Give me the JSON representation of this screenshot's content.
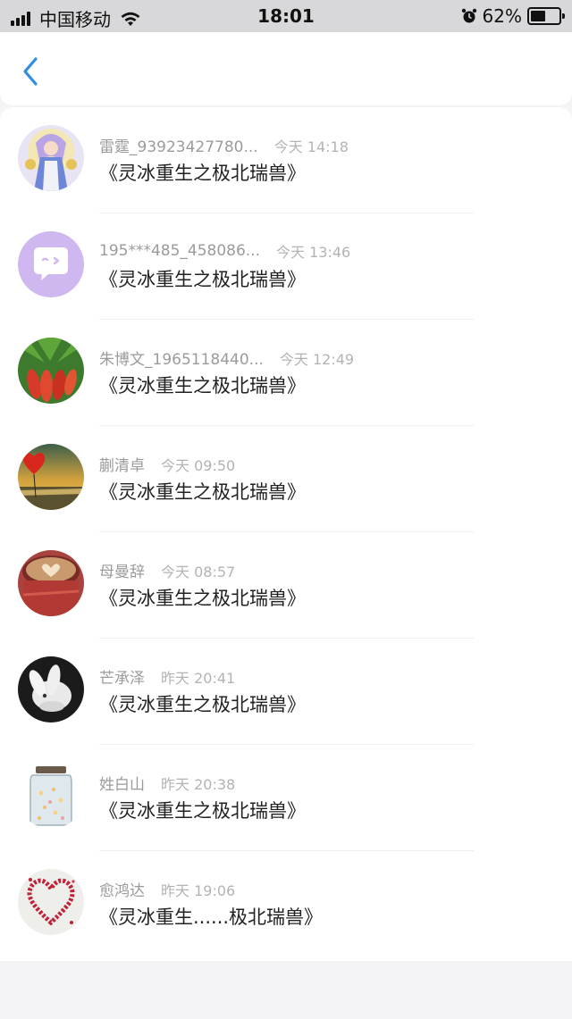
{
  "status_bar": {
    "carrier": "中国移动",
    "time": "18:01",
    "battery_percent": "62%",
    "battery_level": 0.62
  },
  "nav": {
    "back_icon": "chevron-left-icon",
    "accent_color": "#2f8fe5"
  },
  "messages": [
    {
      "name": "雷霆_93923427780...",
      "time": "今天 14:18",
      "title": "《灵冰重生之极北瑞兽》",
      "avatar": "anime-character-avatar"
    },
    {
      "name": "195***485_458086...",
      "time": "今天 13:46",
      "title": "《灵冰重生之极北瑞兽》",
      "avatar": "default-chat-bubble-avatar"
    },
    {
      "name": "朱博文_1965118440...",
      "time": "今天 12:49",
      "title": "《灵冰重生之极北瑞兽》",
      "avatar": "red-peppers-avatar"
    },
    {
      "name": "蒯清卓",
      "time": "今天 09:50",
      "title": "《灵冰重生之极北瑞兽》",
      "avatar": "heart-balloon-sunset-avatar"
    },
    {
      "name": "母曼辞",
      "time": "今天 08:57",
      "title": "《灵冰重生之极北瑞兽》",
      "avatar": "latte-art-avatar"
    },
    {
      "name": "芒承泽",
      "time": "昨天 20:41",
      "title": "《灵冰重生之极北瑞兽》",
      "avatar": "white-rabbit-avatar"
    },
    {
      "name": "姓白山",
      "time": "昨天 20:38",
      "title": "《灵冰重生之极北瑞兽》",
      "avatar": "glass-jar-lights-avatar"
    },
    {
      "name": "愈鸿达",
      "time": "昨天 19:06",
      "title": "《灵冰重生......极北瑞兽》",
      "avatar": "petal-heart-avatar"
    }
  ]
}
